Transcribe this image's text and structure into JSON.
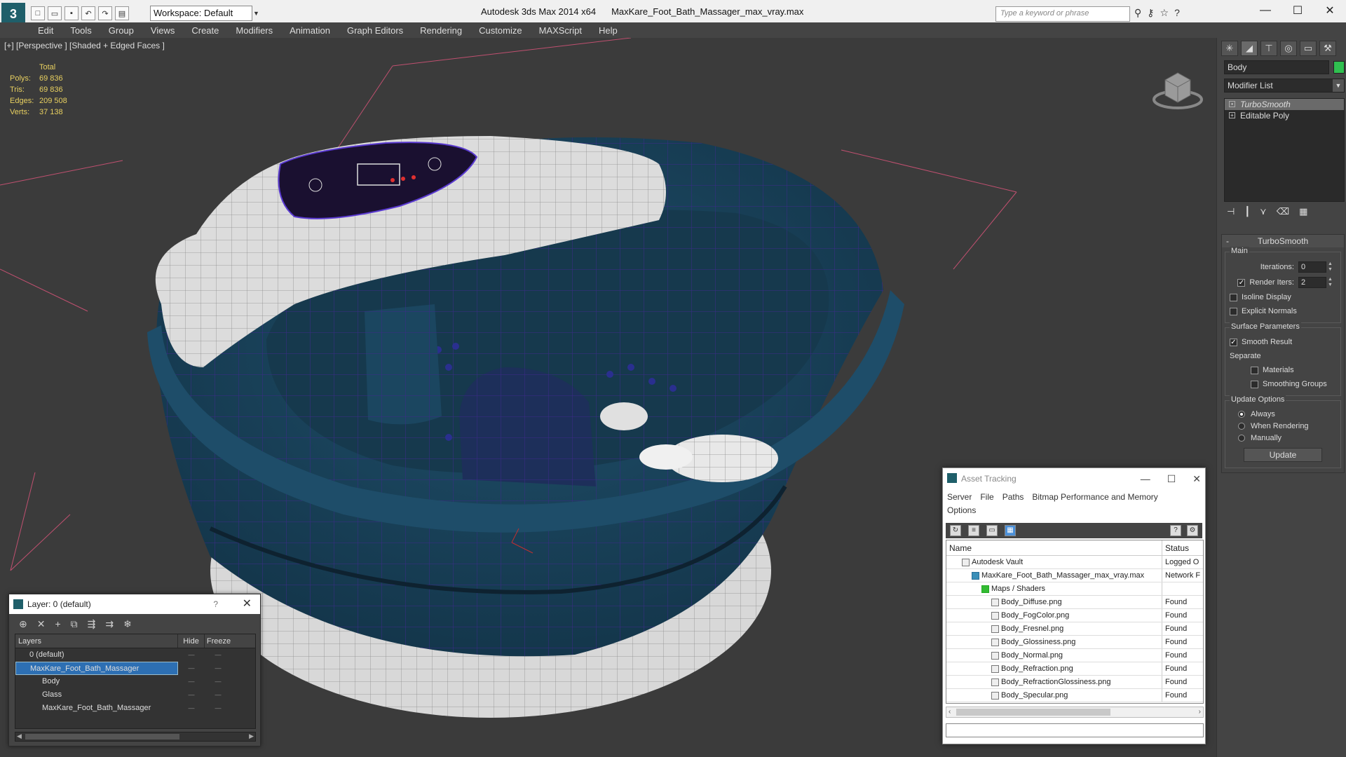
{
  "titlebar": {
    "title": "Autodesk 3ds Max  2014 x64",
    "filename": "MaxKare_Foot_Bath_Massager_max_vray.max",
    "workspace": "Workspace: Default",
    "search_placeholder": "Type a keyword or phrase",
    "logo": "3"
  },
  "menu": [
    "Edit",
    "Tools",
    "Group",
    "Views",
    "Create",
    "Modifiers",
    "Animation",
    "Graph Editors",
    "Rendering",
    "Customize",
    "MAXScript",
    "Help"
  ],
  "viewport": {
    "label": "[+] [Perspective ] [Shaded + Edged Faces ]",
    "stats_header": "Total",
    "stats": [
      {
        "k": "Polys:",
        "v": "69 836"
      },
      {
        "k": "Tris:",
        "v": "69 836"
      },
      {
        "k": "Edges:",
        "v": "209 508"
      },
      {
        "k": "Verts:",
        "v": "37 138"
      }
    ]
  },
  "command_panel": {
    "object_name": "Body",
    "object_color": "#30c050",
    "modifier_list": "Modifier List",
    "stack": [
      "TurboSmooth",
      "Editable Poly"
    ],
    "rollout_title": "TurboSmooth",
    "main_group": "Main",
    "iterations_label": "Iterations:",
    "iterations_value": "0",
    "render_iters_label": "Render Iters:",
    "render_iters_value": "2",
    "isoline": "Isoline Display",
    "explicit_normals": "Explicit Normals",
    "surface_group": "Surface Parameters",
    "smooth_result": "Smooth Result",
    "separate": "Separate",
    "materials": "Materials",
    "smoothing_groups": "Smoothing Groups",
    "update_group": "Update Options",
    "always": "Always",
    "when_rendering": "When Rendering",
    "manually": "Manually",
    "update_btn": "Update"
  },
  "layers": {
    "title": "Layer: 0 (default)",
    "help": "?",
    "col_layers": "Layers",
    "col_hide": "Hide",
    "col_freeze": "Freeze",
    "rows": [
      "0 (default)",
      "MaxKare_Foot_Bath_Massager",
      "Body",
      "Glass",
      "MaxKare_Foot_Bath_Massager"
    ]
  },
  "assets": {
    "title": "Asset Tracking",
    "menu": [
      "Server",
      "File",
      "Paths",
      "Bitmap Performance and Memory",
      "Options"
    ],
    "col_name": "Name",
    "col_status": "Status",
    "rows": [
      {
        "name": "Autodesk Vault",
        "status": "Logged O"
      },
      {
        "name": "MaxKare_Foot_Bath_Massager_max_vray.max",
        "status": "Network F"
      },
      {
        "name": "Maps / Shaders",
        "status": ""
      },
      {
        "name": "Body_Diffuse.png",
        "status": "Found"
      },
      {
        "name": "Body_FogColor.png",
        "status": "Found"
      },
      {
        "name": "Body_Fresnel.png",
        "status": "Found"
      },
      {
        "name": "Body_Glossiness.png",
        "status": "Found"
      },
      {
        "name": "Body_Normal.png",
        "status": "Found"
      },
      {
        "name": "Body_Refraction.png",
        "status": "Found"
      },
      {
        "name": "Body_RefractionGlossiness.png",
        "status": "Found"
      },
      {
        "name": "Body_Specular.png",
        "status": "Found"
      }
    ]
  }
}
